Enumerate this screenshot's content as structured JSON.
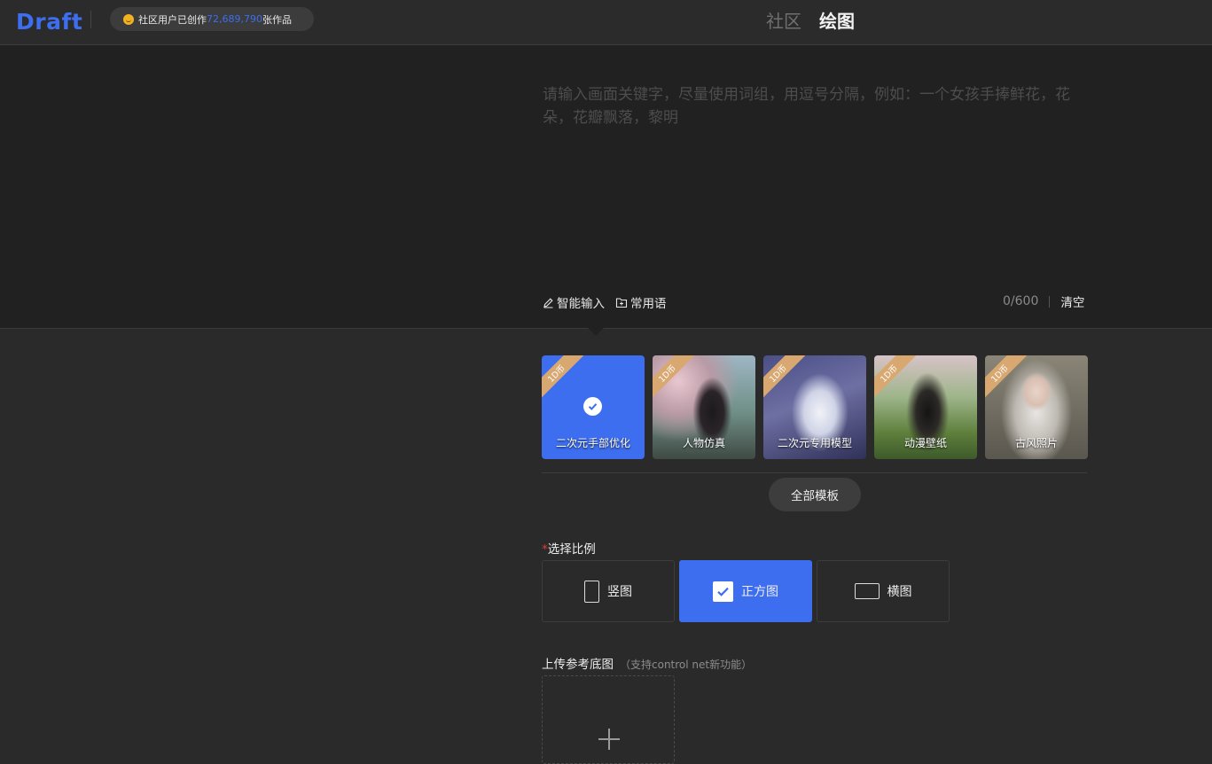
{
  "header": {
    "logo": "Draft",
    "stat": {
      "prefix": "社区用户已创作",
      "count": "72,689,790",
      "suffix": "张作品",
      "icon": "smile-face-icon"
    },
    "tabs": [
      {
        "label": "社区",
        "active": false
      },
      {
        "label": "绘图",
        "active": true
      }
    ]
  },
  "prompt": {
    "placeholder": "请输入画面关键字，尽量使用词组，用逗号分隔，例如：一个女孩手捧鲜花，花朵，花瓣飘落，黎明",
    "tools": [
      {
        "label": "智能输入",
        "icon": "pencil-icon"
      },
      {
        "label": "常用语",
        "icon": "folder-plus-icon"
      }
    ],
    "counter": "0/600",
    "clear_label": "清空"
  },
  "templates": {
    "items": [
      {
        "label": "二次元手部优化",
        "badge": "1D币",
        "selected": true
      },
      {
        "label": "人物仿真",
        "badge": "1D币",
        "selected": false
      },
      {
        "label": "二次元专用模型",
        "badge": "1D币",
        "selected": false
      },
      {
        "label": "动漫壁纸",
        "badge": "1D币",
        "selected": false
      },
      {
        "label": "古风照片",
        "badge": "1D币",
        "selected": false
      }
    ],
    "all_label": "全部模板"
  },
  "ratio": {
    "required_mark": "*",
    "label": "选择比例",
    "options": [
      {
        "label": "竖图",
        "icon": "portrait-icon",
        "selected": false
      },
      {
        "label": "正方图",
        "icon": "square-check-icon",
        "selected": true
      },
      {
        "label": "横图",
        "icon": "landscape-icon",
        "selected": false
      }
    ]
  },
  "upload": {
    "label": "上传参考底图",
    "hint": "（支持control net新功能）"
  },
  "colors": {
    "accent": "#3d6ef0",
    "bg": "#2a2a2a",
    "prompt_bg": "#212121",
    "badge": "#d8a870"
  }
}
